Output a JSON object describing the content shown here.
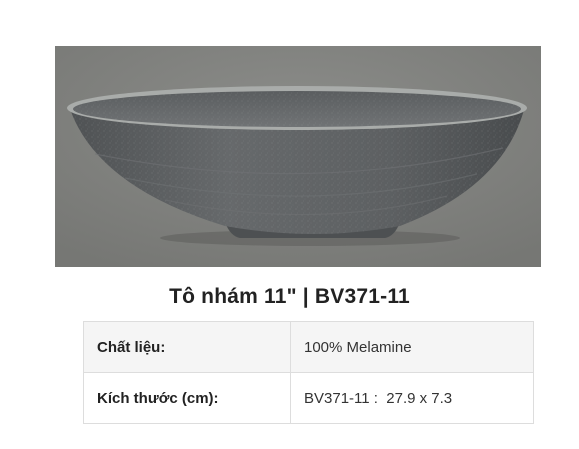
{
  "product": {
    "title": "Tô nhám 11\" | BV371-11",
    "image_alt": "grey speckled melamine bowl",
    "colors": {
      "background": "#7f807d",
      "bowl": "#5f6264",
      "rim": "#a9acaa"
    }
  },
  "specs": [
    {
      "label": "Chất liệu:",
      "value": "100% Melamine"
    },
    {
      "label": "Kích thước (cm):",
      "value": "BV371-11 :  27.9 x 7.3"
    }
  ]
}
